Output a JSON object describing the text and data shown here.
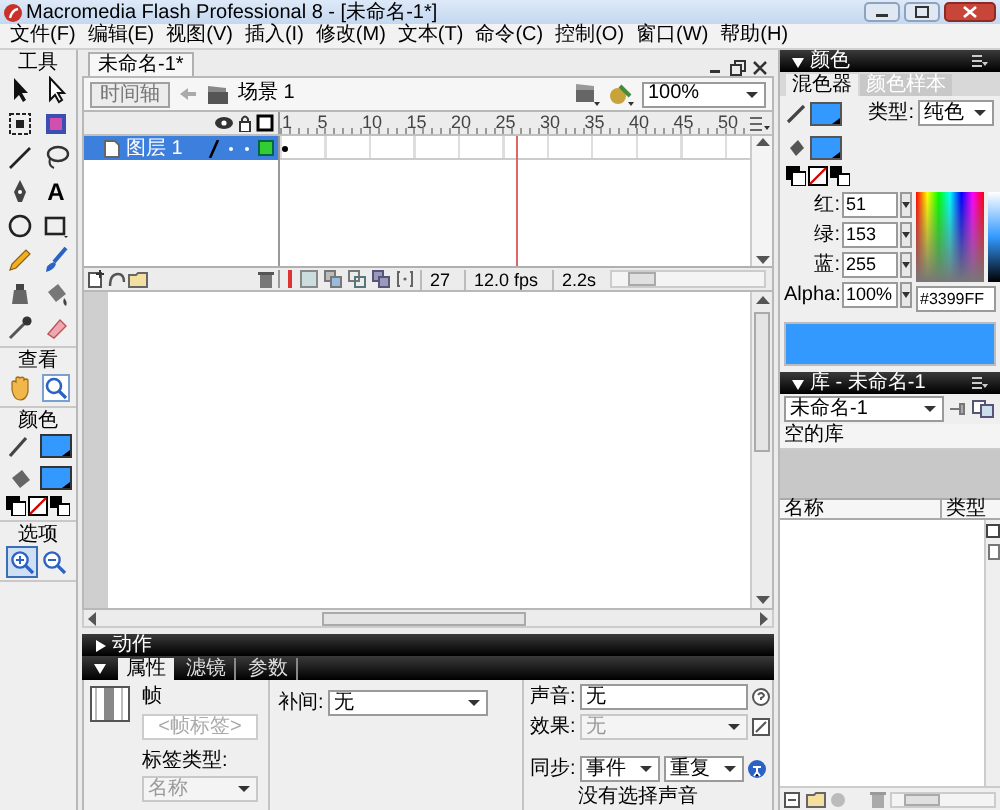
{
  "window": {
    "title": "Macromedia Flash Professional 8 - [未命名-1*]"
  },
  "menu": [
    "文件(F)",
    "编辑(E)",
    "视图(V)",
    "插入(I)",
    "修改(M)",
    "文本(T)",
    "命令(C)",
    "控制(O)",
    "窗口(W)",
    "帮助(H)"
  ],
  "tools": {
    "title": "工具",
    "text_tool": "A",
    "view_title": "查看",
    "color_title": "颜色",
    "options_title": "选项",
    "stroke_swatch": {
      "color": "#3399ff"
    },
    "fill_swatch": {
      "color": "#3399ff"
    },
    "options": [
      {
        "selected": true
      },
      {
        "selected": false
      }
    ]
  },
  "document": {
    "tab": "未命名-1*",
    "timeline_button": "时间轴",
    "scene": "场景 1",
    "zoom": "100%"
  },
  "timeline": {
    "layers": [
      {
        "name": "图层 1",
        "selected": true
      }
    ],
    "ruler": [
      "1",
      "5",
      "10",
      "15",
      "20",
      "25",
      "30",
      "35",
      "40",
      "45",
      "50"
    ],
    "playhead": {
      "level": 0.5
    },
    "current_frame": "27",
    "fps": "12.0 fps",
    "time": "2.2s"
  },
  "actions_panel": {
    "title": "动作",
    "expanded": false
  },
  "properties_panel": {
    "expanded": true,
    "tabs": [
      {
        "label": "属性",
        "selected": true
      },
      {
        "label": "滤镜",
        "selected": false
      },
      {
        "label": "参数",
        "selected": false
      }
    ],
    "frame_label": "帧",
    "frame_name_placeholder": "<帧标签>",
    "label_type_label": "标签类型:",
    "label_type_value": "名称",
    "tween_label": "补间:",
    "tween_value": "无",
    "sound_label": "声音:",
    "sound_value": "无",
    "effect_label": "效果:",
    "effect_value": "无",
    "sync_label": "同步:",
    "sync_value": "事件",
    "repeat_value": "重复",
    "sound_note": "没有选择声音"
  },
  "color_panel": {
    "title": "颜色",
    "tabs": [
      {
        "label": "混色器",
        "selected": true
      },
      {
        "label": "颜色样本",
        "selected": false
      }
    ],
    "type_label": "类型:",
    "type_value": "纯色",
    "stroke_swatch": {
      "color": "#3399ff"
    },
    "fill_swatch": {
      "color": "#3399ff"
    },
    "channels": [
      {
        "label": "红:",
        "value": "51"
      },
      {
        "label": "绿:",
        "value": "153"
      },
      {
        "label": "蓝:",
        "value": "255"
      },
      {
        "label": "Alpha:",
        "value": "100%"
      }
    ],
    "hex": "#3399FF",
    "preview": {
      "color": "#3399ff"
    }
  },
  "library_panel": {
    "title": "库 - 未命名-1",
    "document": "未命名-1",
    "status": "空的库",
    "columns": [
      "名称",
      "类型"
    ]
  }
}
